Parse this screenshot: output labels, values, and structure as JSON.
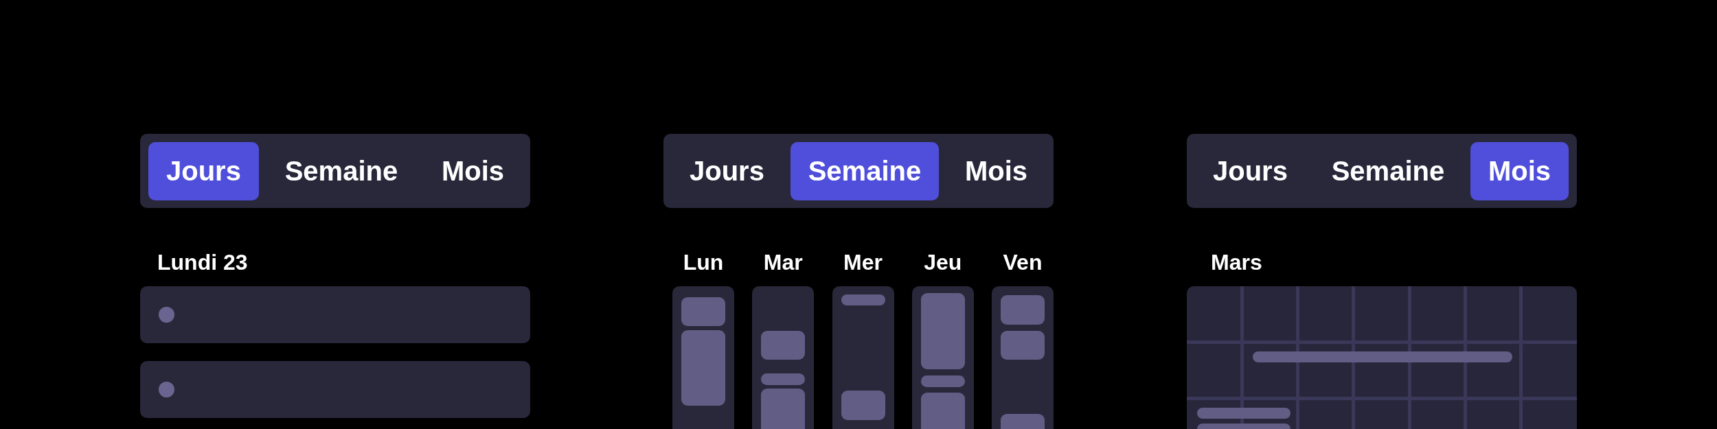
{
  "views": [
    {
      "kind": "day",
      "tabs": [
        {
          "label": "Jours",
          "selected": true
        },
        {
          "label": "Semaine",
          "selected": false
        },
        {
          "label": "Mois",
          "selected": false
        }
      ],
      "heading": "Lundi 23"
    },
    {
      "kind": "week",
      "tabs": [
        {
          "label": "Jours",
          "selected": false
        },
        {
          "label": "Semaine",
          "selected": true
        },
        {
          "label": "Mois",
          "selected": false
        }
      ],
      "days": [
        "Lun",
        "Mar",
        "Mer",
        "Jeu",
        "Ven"
      ]
    },
    {
      "kind": "month",
      "tabs": [
        {
          "label": "Jours",
          "selected": false
        },
        {
          "label": "Semaine",
          "selected": false
        },
        {
          "label": "Mois",
          "selected": true
        }
      ],
      "heading": "Mars"
    }
  ]
}
